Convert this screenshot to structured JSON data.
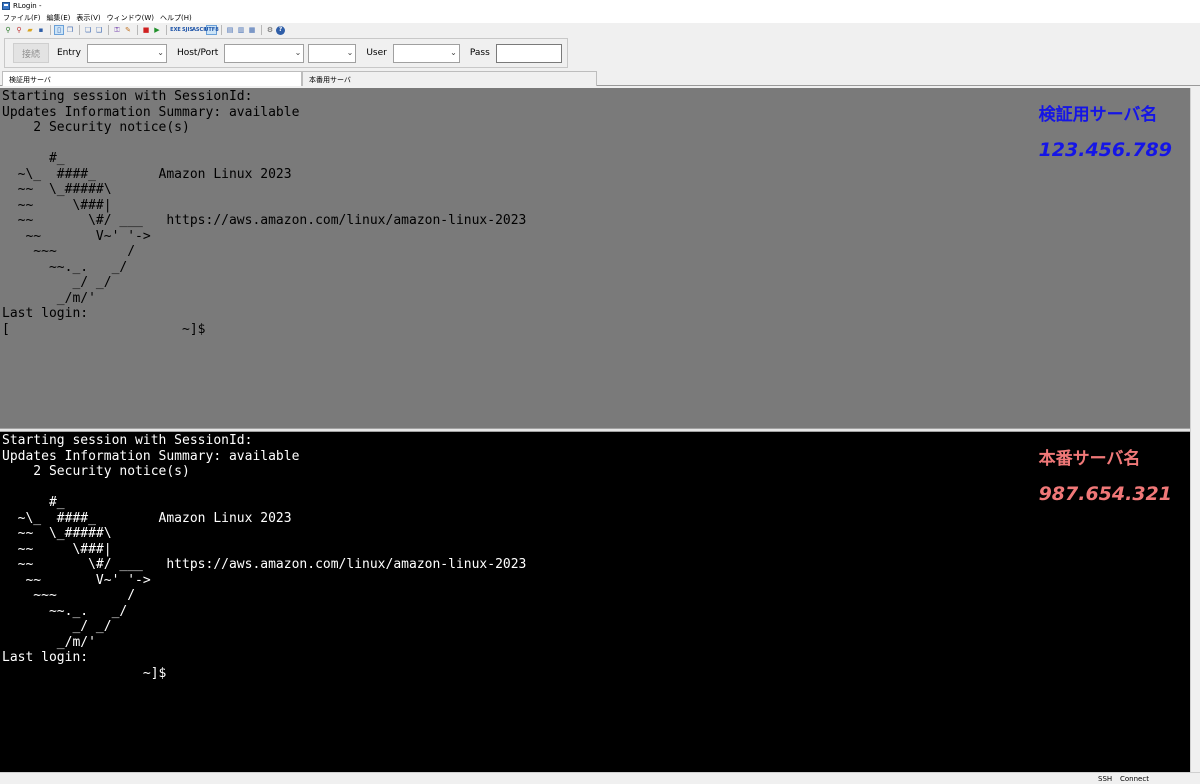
{
  "window": {
    "title": "RLogin -"
  },
  "menu": [
    "ファイル(F)",
    "編集(E)",
    "表示(V)",
    "ウィンドウ(W)",
    "ヘルプ(H)"
  ],
  "toolbar": {
    "text_buttons": [
      "EXE",
      "SJIS",
      "ASCII",
      "UTF8"
    ]
  },
  "connection": {
    "connect_label": "接続",
    "entry_label": "Entry",
    "hostport_label": "Host/Port",
    "user_label": "User",
    "pass_label": "Pass"
  },
  "tabs": [
    {
      "label": "検証用サーバ",
      "active": true
    },
    {
      "label": "本番用サーバ",
      "active": false
    }
  ],
  "terminals": {
    "top": {
      "lines": [
        "Starting session with SessionId:",
        "Updates Information Summary: available",
        "    2 Security notice(s)",
        "",
        "      #_",
        "  ~\\_  ####_        Amazon Linux 2023",
        "  ~~  \\_#####\\",
        "  ~~     \\###|",
        "  ~~       \\#/ ___   https://aws.amazon.com/linux/amazon-linux-2023",
        "   ~~       V~' '->",
        "    ~~~         /",
        "      ~~._.   _/",
        "         _/ _/",
        "       _/m/'",
        "Last login:",
        "[                      ~]$"
      ],
      "server_name": "検証用サーバ名",
      "server_ip": "123.456.789",
      "background": "#7a7a7a",
      "label_color": "#1515e6"
    },
    "bottom": {
      "lines": [
        "Starting session with SessionId:",
        "Updates Information Summary: available",
        "    2 Security notice(s)",
        "",
        "      #_",
        "  ~\\_  ####_        Amazon Linux 2023",
        "  ~~  \\_#####\\",
        "  ~~     \\###|",
        "  ~~       \\#/ ___   https://aws.amazon.com/linux/amazon-linux-2023",
        "   ~~       V~' '->",
        "    ~~~         /",
        "      ~~._.   _/",
        "         _/ _/",
        "       _/m/'",
        "Last login:",
        "                  ~]$"
      ],
      "server_name": "本番サーバ名",
      "server_ip": "987.654.321",
      "background": "#000000",
      "label_color": "#f07878"
    }
  },
  "status": {
    "protocol": "SSH",
    "state": "Connect"
  }
}
